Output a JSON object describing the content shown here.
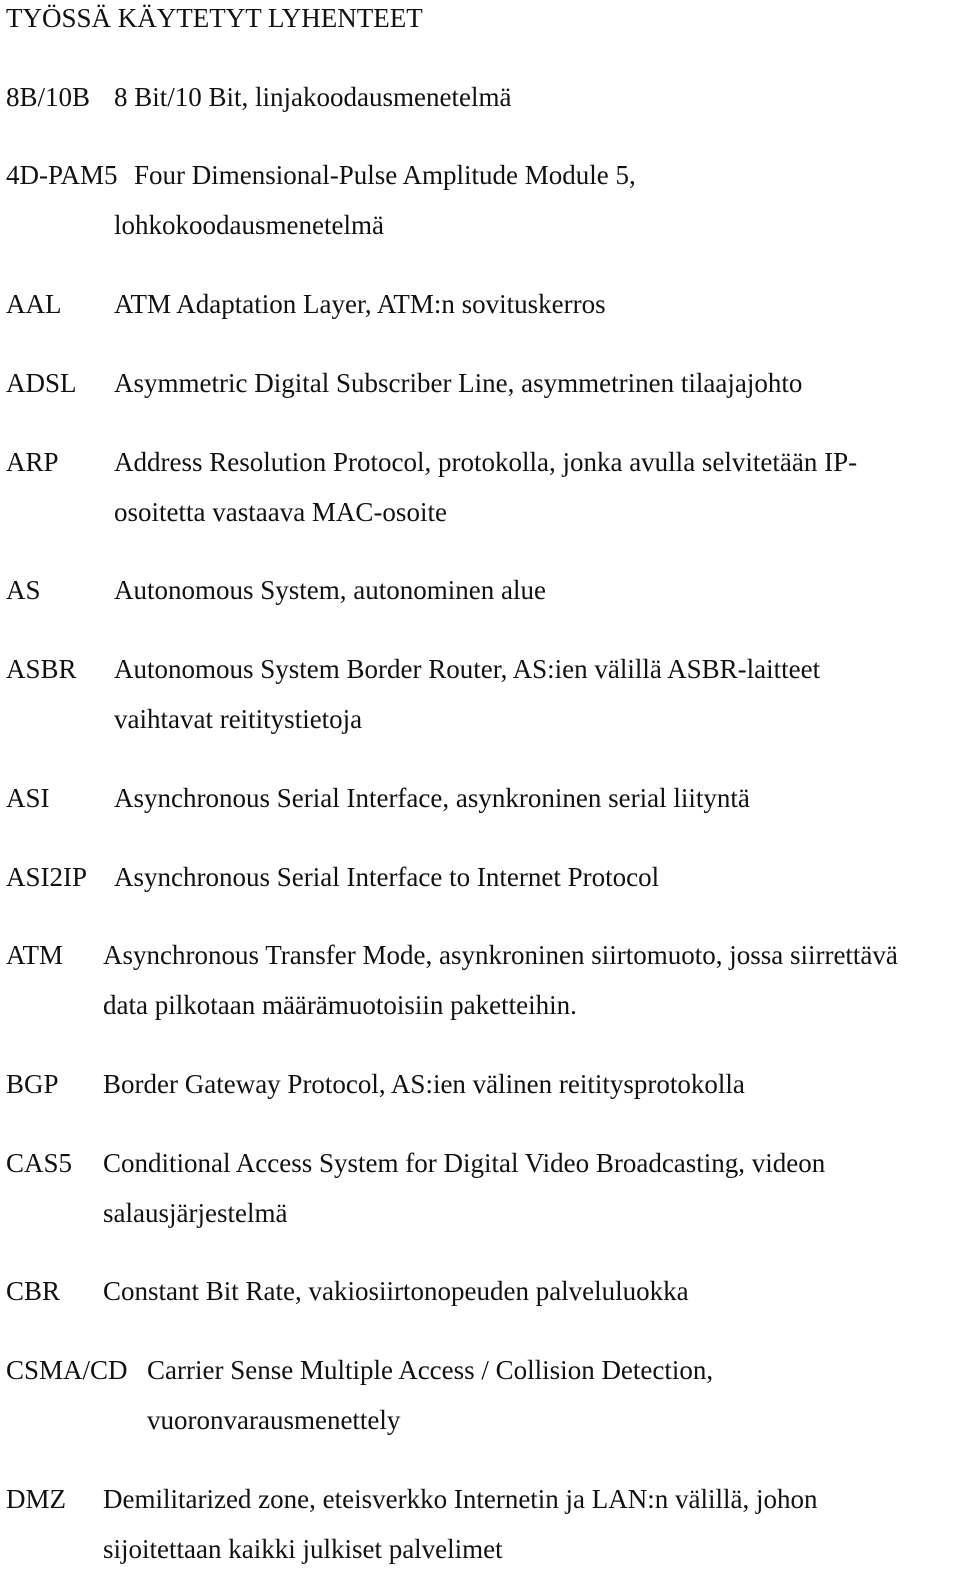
{
  "title": "TYÖSSÄ KÄYTETYT LYHENTEET",
  "entries": [
    {
      "abbr": "8B/10B",
      "lines": [
        "8 Bit/10 Bit, linjakoodausmenetelmä"
      ]
    },
    {
      "abbr": "4D-PAM5",
      "lines": [
        "Four Dimensional-Pulse Amplitude Module 5,",
        "lohkokoodausmenetelmä"
      ]
    },
    {
      "abbr": "AAL",
      "lines": [
        "ATM Adaptation Layer, ATM:n sovituskerros"
      ]
    },
    {
      "abbr": "ADSL",
      "lines": [
        "Asymmetric Digital Subscriber Line, asymmetrinen tilaajajohto"
      ]
    },
    {
      "abbr": "ARP",
      "lines": [
        "Address Resolution Protocol, protokolla, jonka avulla selvitetään IP-",
        "osoitetta vastaava MAC-osoite"
      ]
    },
    {
      "abbr": "AS",
      "lines": [
        "Autonomous System, autonominen alue"
      ]
    },
    {
      "abbr": "ASBR",
      "lines": [
        "Autonomous System Border Router, AS:ien välillä ASBR-laitteet",
        "vaihtavat reititystietoja"
      ]
    },
    {
      "abbr": "ASI",
      "lines": [
        "Asynchronous Serial Interface, asynkroninen serial liityntä"
      ]
    },
    {
      "abbr": "ASI2IP",
      "lines": [
        "Asynchronous Serial Interface to Internet Protocol"
      ]
    },
    {
      "abbr": "ATM",
      "lines": [
        "Asynchronous Transfer Mode, asynkroninen siirtomuoto, jossa siirrettävä",
        "data pilkotaan määrämuotoisiin paketteihin."
      ]
    },
    {
      "abbr": "BGP",
      "lines": [
        "Border Gateway Protocol, AS:ien välinen reititysprotokolla"
      ]
    },
    {
      "abbr": "CAS5",
      "lines": [
        "Conditional Access System for Digital Video Broadcasting, videon",
        "salausjärjestelmä"
      ]
    },
    {
      "abbr": "CBR",
      "lines": [
        "Constant Bit Rate, vakiosiirtonopeuden palveluluokka"
      ]
    },
    {
      "abbr": "CSMA/CD",
      "lines": [
        "Carrier Sense Multiple Access / Collision Detection,",
        "vuoronvarausmenettely"
      ]
    },
    {
      "abbr": "DMZ",
      "lines": [
        "Demilitarized zone, eteisverkko Internetin ja LAN:n välillä, johon",
        "sijoitettaan kaikki julkiset palvelimet"
      ]
    }
  ]
}
